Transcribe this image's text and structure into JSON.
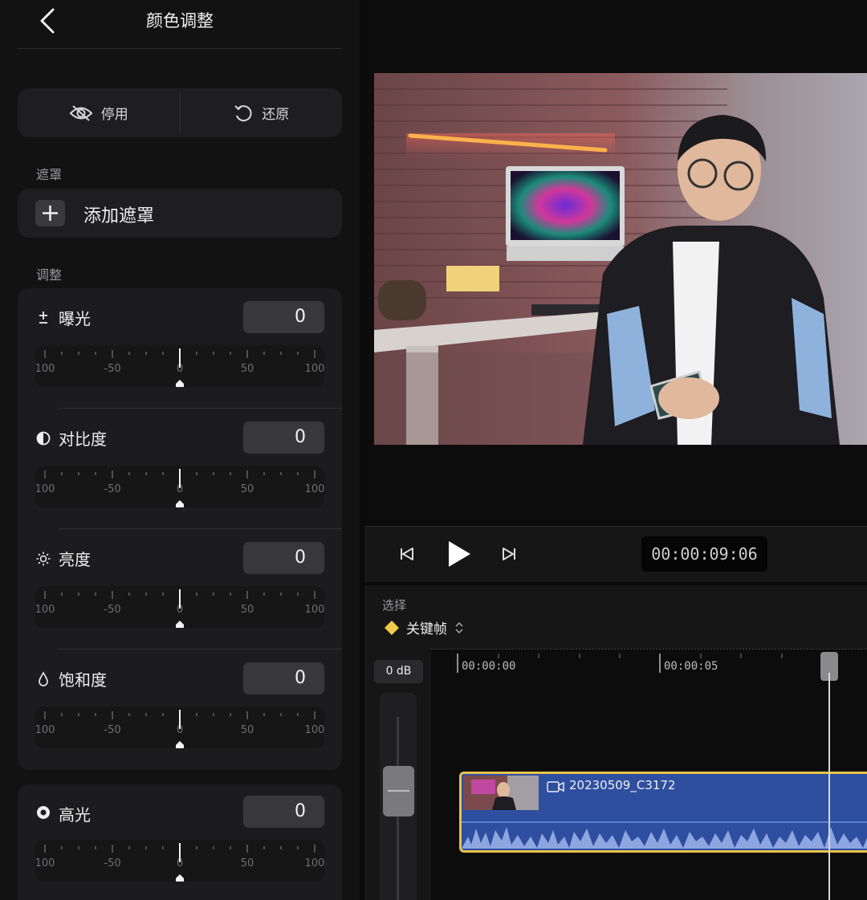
{
  "panel": {
    "title": "颜色调整",
    "disable_label": "停用",
    "reset_label": "还原",
    "mask_section": "遮罩",
    "add_mask_label": "添加遮罩",
    "adjust_section": "调整"
  },
  "adjustments": [
    {
      "label": "曝光",
      "icon": "plus-minus-icon",
      "value": "0"
    },
    {
      "label": "对比度",
      "icon": "contrast-icon",
      "value": "0"
    },
    {
      "label": "亮度",
      "icon": "sun-icon",
      "value": "0"
    },
    {
      "label": "饱和度",
      "icon": "drop-icon",
      "value": "0"
    },
    {
      "label": "高光",
      "icon": "highlight-icon",
      "value": "0"
    }
  ],
  "slider_ticks": [
    "100",
    "-50",
    "0",
    "50",
    "100"
  ],
  "transport": {
    "timecode": "00:00:09:06"
  },
  "timeline": {
    "select_label": "选择",
    "keyframe_label": "关键帧",
    "volume_label": "0 dB",
    "ruler_marks": [
      "00:00:00",
      "00:00:05"
    ],
    "clip_name": "20230509_C3172"
  },
  "colors": {
    "accent_yellow": "#e6c34a",
    "clip_blue": "#2e4fa0",
    "panel_bg": "#121213"
  }
}
